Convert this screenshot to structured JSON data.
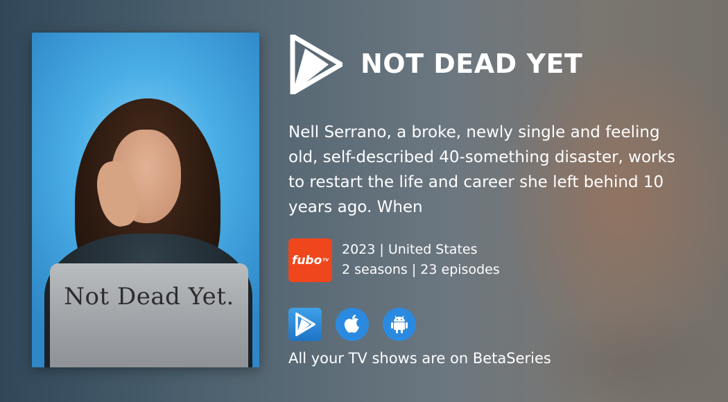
{
  "show": {
    "title": "NOT DEAD YET",
    "poster_text": "Not Dead Yet.",
    "description": "Nell Serrano, a broke, newly single and feeling old, self-described 40-something disaster, works to restart the life and career she left behind 10 years ago. When",
    "year_country": "2023 | United States",
    "seasons_episodes": "2 seasons | 23 episodes"
  },
  "provider": {
    "name": "fubo",
    "superscript": "TV",
    "color": "#f0461c"
  },
  "apps": [
    {
      "icon": "betaseries-app-icon"
    },
    {
      "icon": "apple-icon"
    },
    {
      "icon": "android-icon"
    }
  ],
  "tagline": "All your TV shows are on BetaSeries",
  "colors": {
    "accent": "#2b8ae0",
    "text": "#ffffff"
  }
}
